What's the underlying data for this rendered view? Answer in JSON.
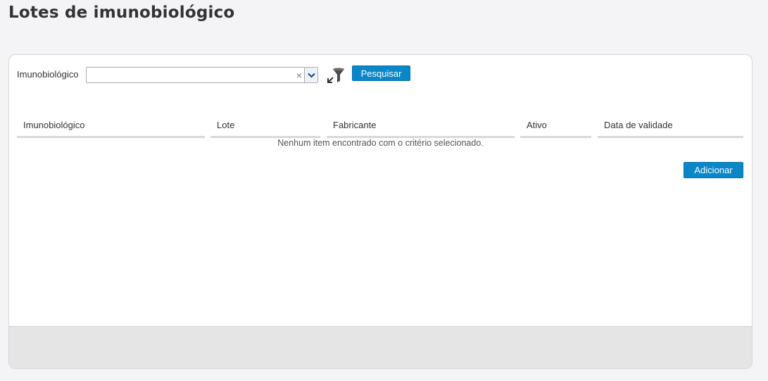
{
  "page": {
    "title": "Lotes de imunobiológico"
  },
  "filter": {
    "label": "Imunobiológico",
    "select_value": "",
    "clear_glyph": "×",
    "search_label": "Pesquisar",
    "icons": {
      "filter": "filter-icon",
      "dropdown": "chevron-down-icon",
      "clear": "close-icon"
    }
  },
  "table": {
    "columns": [
      "Imunobiológico",
      "Lote",
      "Fabricante",
      "Ativo",
      "Data de validade"
    ],
    "rows": [],
    "empty_message": "Nenhum item encontrado com o critério selecionado."
  },
  "actions": {
    "add_label": "Adicionar"
  },
  "colors": {
    "primary_button": "#0a87c8",
    "header_underline": "#d9d9d9",
    "footer": "#e5e5e5"
  }
}
